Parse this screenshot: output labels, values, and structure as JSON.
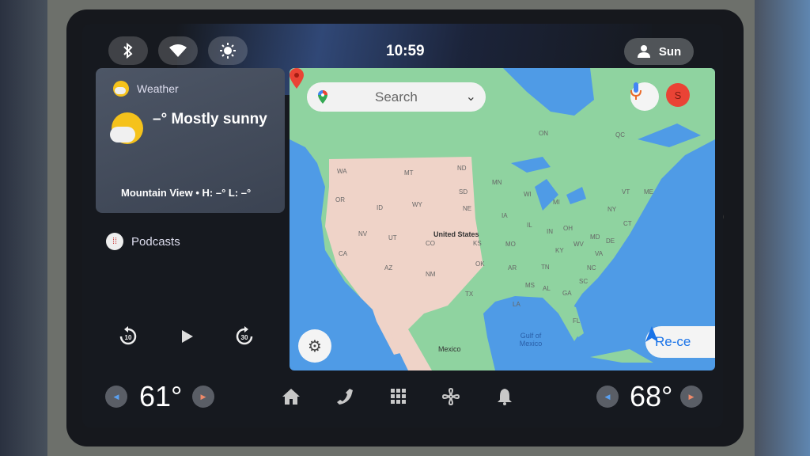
{
  "status_bar": {
    "bluetooth_icon": "bluetooth-icon",
    "wifi_icon": "wifi-icon",
    "brightness_icon": "brightness-icon",
    "time": "10:59",
    "user_name": "Sun"
  },
  "weather": {
    "title": "Weather",
    "condition": "–° Mostly sunny",
    "location_line": "Mountain View • H: –° L: –°"
  },
  "podcasts": {
    "title": "Podcasts",
    "rewind_label": "10",
    "forward_label": "30"
  },
  "map": {
    "search_placeholder": "Search",
    "avatar_letter": "S",
    "recenter_label": "Re-ce",
    "labels": {
      "country_us": "United States",
      "country_mx": "Mexico",
      "gulf": "Gulf of Mexico",
      "states": [
        "WA",
        "OR",
        "CA",
        "NV",
        "ID",
        "MT",
        "WY",
        "UT",
        "AZ",
        "CO",
        "NM",
        "ND",
        "SD",
        "NE",
        "KS",
        "OK",
        "TX",
        "MN",
        "IA",
        "MO",
        "AR",
        "LA",
        "WI",
        "IL",
        "MI",
        "IN",
        "OH",
        "KY",
        "TN",
        "MS",
        "AL",
        "GA",
        "FL",
        "SC",
        "NC",
        "VA",
        "WV",
        "MD",
        "DE",
        "NY",
        "VT",
        "ME",
        "CT",
        "ON",
        "QC"
      ]
    }
  },
  "bottom_bar": {
    "left_temp": "61°",
    "right_temp": "68°",
    "nav": [
      "home",
      "phone",
      "apps",
      "fan",
      "notifications"
    ]
  },
  "colors": {
    "water": "#4f9be6",
    "land_green": "#8fd3a0",
    "land_desert": "#efd3c8",
    "accent_blue": "#1a73e8",
    "avatar_red": "#ea4335"
  }
}
